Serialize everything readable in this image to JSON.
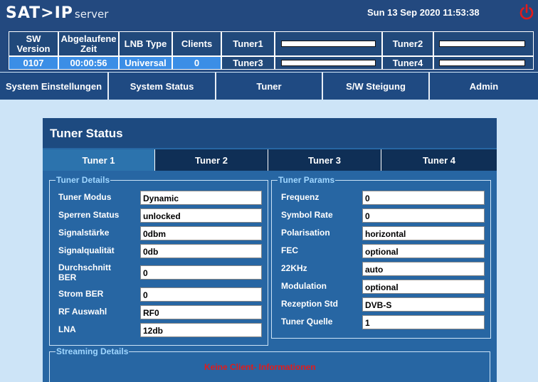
{
  "header": {
    "logo_main": "SAT>IP",
    "logo_sub": "server",
    "datetime": "Sun 13 Sep 2020 11:53:38",
    "power_icon": "power-icon",
    "color_power": "#e21b1b"
  },
  "info": {
    "sw_version_label": "SW Version",
    "sw_version_value": "0107",
    "elapsed_label": "Abgelaufene Zeit",
    "elapsed_value": "00:00:56",
    "lnb_label": "LNB Type",
    "lnb_value": "Universal",
    "clients_label": "Clients",
    "clients_value": "0",
    "tuner1_label": "Tuner1",
    "tuner2_label": "Tuner2",
    "tuner3_label": "Tuner3",
    "tuner4_label": "Tuner4"
  },
  "nav": {
    "items": [
      "System Einstellungen",
      "System Status",
      "Tuner",
      "S/W Steigung",
      "Admin"
    ]
  },
  "panel": {
    "title": "Tuner Status",
    "tabs": [
      "Tuner 1",
      "Tuner 2",
      "Tuner 3",
      "Tuner 4"
    ],
    "active_tab": 0,
    "details": {
      "legend": "Tuner Details",
      "rows": [
        {
          "label": "Tuner Modus",
          "value": "Dynamic"
        },
        {
          "label": "Sperren Status",
          "value": "unlocked"
        },
        {
          "label": "Signalstärke",
          "value": "0dbm"
        },
        {
          "label": "Signalqualität",
          "value": "0db"
        },
        {
          "label": "Durchschnitt BER",
          "value": "0"
        },
        {
          "label": "Strom BER",
          "value": "0"
        },
        {
          "label": "RF Auswahl",
          "value": "RF0"
        },
        {
          "label": "LNA",
          "value": "12db"
        }
      ]
    },
    "params": {
      "legend": "Tuner Params",
      "rows": [
        {
          "label": "Frequenz",
          "value": "0"
        },
        {
          "label": "Symbol Rate",
          "value": "0"
        },
        {
          "label": "Polarisation",
          "value": "horizontal"
        },
        {
          "label": "FEC",
          "value": "optional"
        },
        {
          "label": "22KHz",
          "value": "auto"
        },
        {
          "label": "Modulation",
          "value": "optional"
        },
        {
          "label": "Rezeption Std",
          "value": "DVB-S"
        },
        {
          "label": "Tuner Quelle",
          "value": "1"
        }
      ]
    },
    "streaming": {
      "legend": "Streaming Details",
      "message": "Keine Client- Informationen"
    }
  }
}
